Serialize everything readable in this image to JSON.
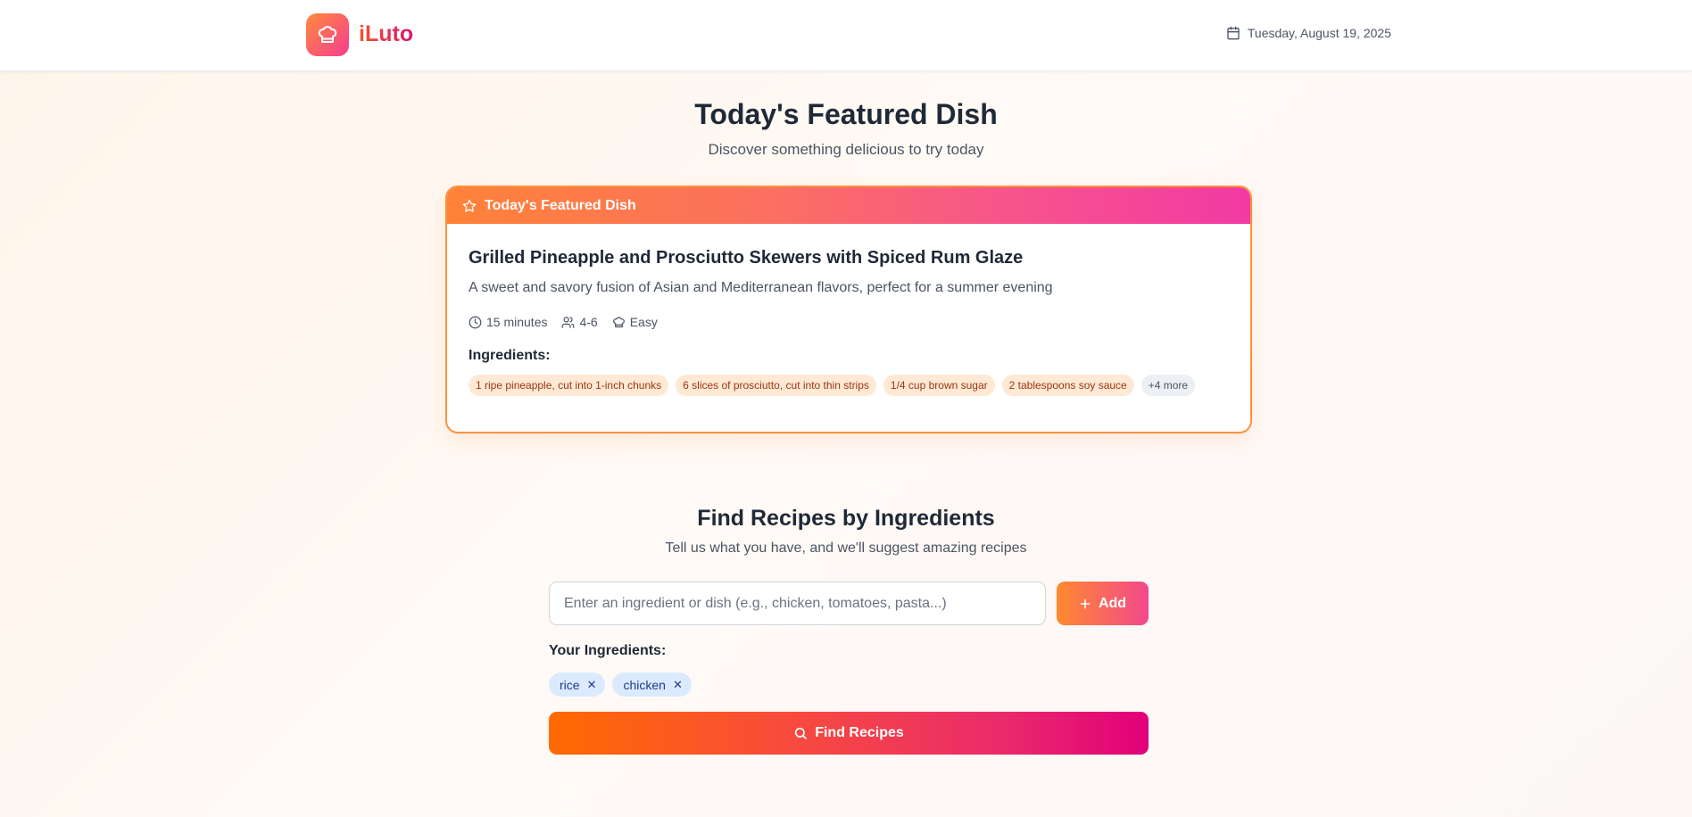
{
  "header": {
    "app_name": "iLuto",
    "logo_icon": "chef-hat-icon",
    "date": "Tuesday, August 19, 2025"
  },
  "featured": {
    "page_title": "Today's Featured Dish",
    "page_subtitle": "Discover something delicious to try today",
    "banner_label": "Today's Featured Dish",
    "dish_title": "Grilled Pineapple and Prosciutto Skewers with Spiced Rum Glaze",
    "dish_description": "A sweet and savory fusion of Asian and Mediterranean flavors, perfect for a summer evening",
    "time": "15 minutes",
    "servings": "4-6",
    "difficulty": "Easy",
    "ingredients_label": "Ingredients:",
    "ingredients": [
      "1 ripe pineapple, cut into 1-inch chunks",
      "6 slices of prosciutto, cut into thin strips",
      "1/4 cup brown sugar",
      "2 tablespoons soy sauce"
    ],
    "more_label": "+4 more"
  },
  "finder": {
    "title": "Find Recipes by Ingredients",
    "subtitle": "Tell us what you have, and we'll suggest amazing recipes",
    "input_value": "",
    "input_placeholder": "Enter an ingredient or dish (e.g., chicken, tomatoes, pasta...)",
    "add_label": "Add",
    "your_ingredients_label": "Your Ingredients:",
    "chips": [
      "rice",
      "chicken"
    ],
    "find_label": "Find Recipes"
  },
  "colors": {
    "brand_orange": "#ff8a3d",
    "brand_pink": "#f53d8f",
    "chip_bg": "#dbeafe",
    "tag_bg": "#ffe9d4"
  }
}
